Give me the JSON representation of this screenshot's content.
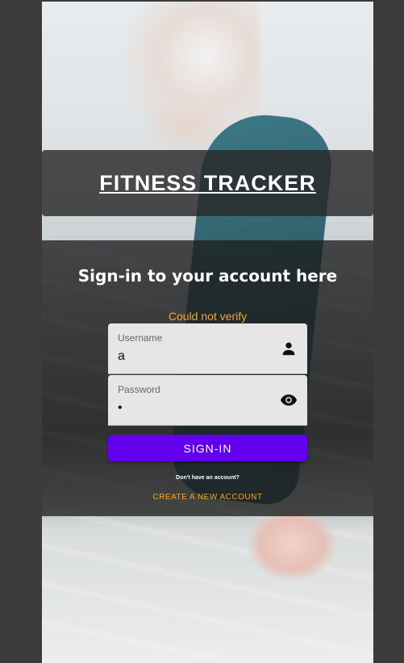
{
  "app": {
    "title": "FITNESS TRACKER"
  },
  "login": {
    "heading": "Sign-in to your account here",
    "error": "Could not verify",
    "username": {
      "label": "Username",
      "value": "a",
      "icon": "person-icon"
    },
    "password": {
      "label": "Password",
      "value": "•",
      "icon": "eye-icon"
    },
    "submit_label": "SIGN-IN",
    "no_account_text": "Don't have an account?",
    "create_account_label": "CREATE A NEW ACCOUNT"
  },
  "colors": {
    "accent": "#6200ee",
    "error": "#f5a623",
    "link": "#f5a623"
  }
}
